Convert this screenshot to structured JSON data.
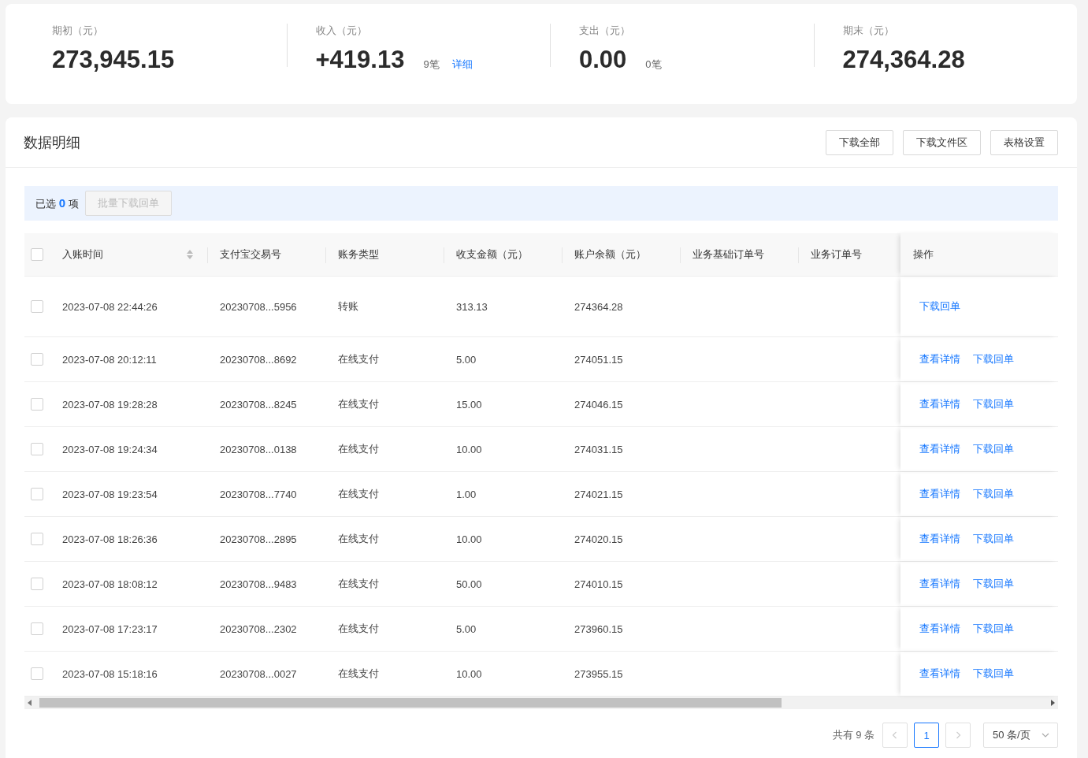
{
  "summary": [
    {
      "label": "期初（元）",
      "value": "273,945.15"
    },
    {
      "label": "收入（元）",
      "value": "+419.13",
      "count": "9笔",
      "link": "详细"
    },
    {
      "label": "支出（元）",
      "value": "0.00",
      "count": "0笔"
    },
    {
      "label": "期末（元）",
      "value": "274,364.28"
    }
  ],
  "detail": {
    "title": "数据明细",
    "buttons": [
      "下载全部",
      "下载文件区",
      "表格设置"
    ],
    "selection": {
      "prefix": "已选",
      "count": "0",
      "suffix": "项",
      "bulk_button": {
        "label": "批量下载回单",
        "disabled": true
      }
    },
    "table": {
      "header_checked": false,
      "columns": [
        {
          "label": "入账时间",
          "sortable": true
        },
        {
          "label": "支付宝交易号",
          "sortable": false
        },
        {
          "label": "账务类型",
          "sortable": false
        },
        {
          "label": "收支金额（元）",
          "sortable": false
        },
        {
          "label": "账户余额（元）",
          "sortable": false
        },
        {
          "label": "业务基础订单号",
          "sortable": false
        },
        {
          "label": "业务订单号",
          "sortable": false
        },
        {
          "label": "操作",
          "sortable": false
        }
      ],
      "rows": [
        {
          "checked": false,
          "time": "2023-07-08 22:44:26",
          "trade_no": "20230708...5956",
          "type": "转账",
          "amount": "313.13",
          "balance": "274364.28",
          "actions": [
            "下载回单"
          ]
        },
        {
          "checked": false,
          "time": "2023-07-08 20:12:11",
          "trade_no": "20230708...8692",
          "type": "在线支付",
          "amount": "5.00",
          "balance": "274051.15",
          "actions": [
            "查看详情",
            "下载回单"
          ]
        },
        {
          "checked": false,
          "time": "2023-07-08 19:28:28",
          "trade_no": "20230708...8245",
          "type": "在线支付",
          "amount": "15.00",
          "balance": "274046.15",
          "actions": [
            "查看详情",
            "下载回单"
          ]
        },
        {
          "checked": false,
          "time": "2023-07-08 19:24:34",
          "trade_no": "20230708...0138",
          "type": "在线支付",
          "amount": "10.00",
          "balance": "274031.15",
          "actions": [
            "查看详情",
            "下载回单"
          ]
        },
        {
          "checked": false,
          "time": "2023-07-08 19:23:54",
          "trade_no": "20230708...7740",
          "type": "在线支付",
          "amount": "1.00",
          "balance": "274021.15",
          "actions": [
            "查看详情",
            "下载回单"
          ]
        },
        {
          "checked": false,
          "time": "2023-07-08 18:26:36",
          "trade_no": "20230708...2895",
          "type": "在线支付",
          "amount": "10.00",
          "balance": "274020.15",
          "actions": [
            "查看详情",
            "下载回单"
          ]
        },
        {
          "checked": false,
          "time": "2023-07-08 18:08:12",
          "trade_no": "20230708...9483",
          "type": "在线支付",
          "amount": "50.00",
          "balance": "274010.15",
          "actions": [
            "查看详情",
            "下载回单"
          ]
        },
        {
          "checked": false,
          "time": "2023-07-08 17:23:17",
          "trade_no": "20230708...2302",
          "type": "在线支付",
          "amount": "5.00",
          "balance": "273960.15",
          "actions": [
            "查看详情",
            "下载回单"
          ]
        },
        {
          "checked": false,
          "time": "2023-07-08 15:18:16",
          "trade_no": "20230708...0027",
          "type": "在线支付",
          "amount": "10.00",
          "balance": "273955.15",
          "actions": [
            "查看详情",
            "下载回单"
          ]
        }
      ]
    },
    "pagination": {
      "total": "共有 9 条",
      "prev_disabled": true,
      "next_disabled": true,
      "pages": [
        {
          "label": "1",
          "selected": true
        }
      ],
      "page_size": "50 条/页"
    }
  }
}
